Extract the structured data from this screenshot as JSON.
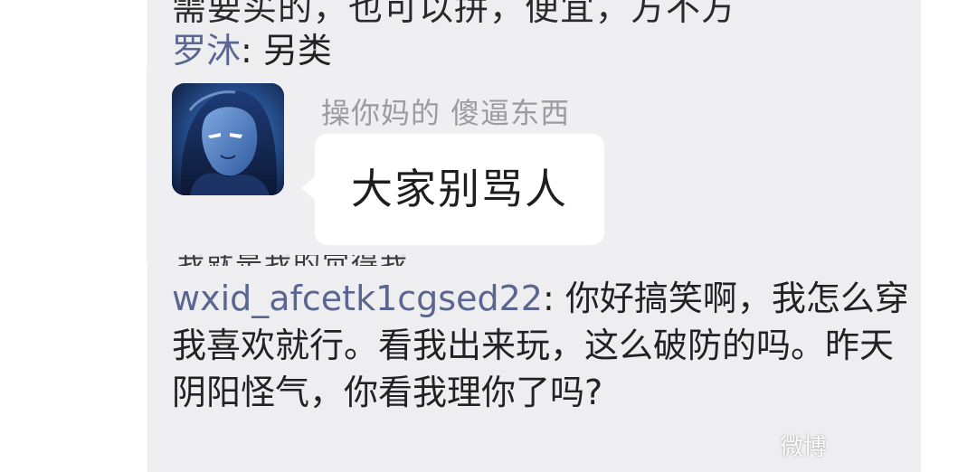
{
  "chat": {
    "cutoff_line": "需要买的，也可以拼，便宜，方不方",
    "message1": {
      "sender": "罗沐",
      "separator": ": ",
      "text": "另类"
    },
    "quoted": {
      "sender_text": "操你妈的 傻逼东西",
      "bubble_text": "大家别骂人",
      "partial_line": "我就是我的觉得我"
    },
    "message2": {
      "sender": "wxid_afcetk1cgsed22",
      "separator": ": ",
      "text": "你好搞笑啊，我怎么穿我喜欢就行。看我出来玩，这么破防的吗。昨天阴阳怪气，你看我理你了吗?"
    }
  },
  "watermark": "微博",
  "colors": {
    "panel_bg": "#eeeef0",
    "sender_color": "#5b6690",
    "text_color": "#222222",
    "bubble_bg": "#ffffff"
  }
}
